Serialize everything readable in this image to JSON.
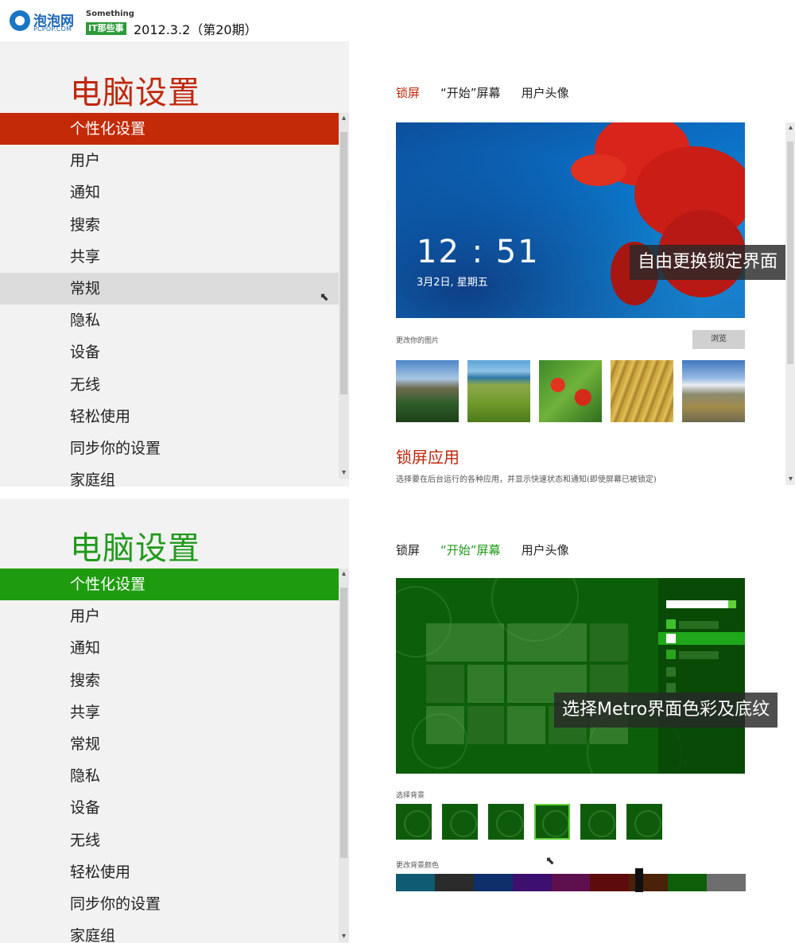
{
  "header": {
    "logo_text": "泡泡网",
    "logo_sub": "PCPOP.COM",
    "something_top": "Something",
    "something_bot": "IT那些事",
    "issue": "2012.3.2（第20期）"
  },
  "panels": [
    {
      "sidebar_title": "电脑设置",
      "items": [
        "个性化设置",
        "用户",
        "通知",
        "搜索",
        "共享",
        "常规",
        "隐私",
        "设备",
        "无线",
        "轻松使用",
        "同步你的设置",
        "家庭组"
      ],
      "tabs": [
        "锁屏",
        "“开始”屏幕",
        "用户头像"
      ],
      "clock": "12 : 51",
      "clock_date": "3月2日, 星期五",
      "callout": "自由更换锁定界面",
      "change_picture_label": "更改你的图片",
      "browse_label": "浏览",
      "section_title": "锁屏应用",
      "section_desc": "选择要在后台运行的各种应用，并显示快速状态和通知(即使屏幕已被锁定)"
    },
    {
      "sidebar_title": "电脑设置",
      "items": [
        "个性化设置",
        "用户",
        "通知",
        "搜索",
        "共享",
        "常规",
        "隐私",
        "设备",
        "无线",
        "轻松使用",
        "同步你的设置",
        "家庭组"
      ],
      "tabs": [
        "锁屏",
        "“开始”屏幕",
        "用户头像"
      ],
      "callout": "选择Metro界面色彩及底纹",
      "select_bg_label": "选择背景",
      "change_bg_color_label": "更改背景颜色",
      "colors": [
        "#0e5b73",
        "#2b2b2b",
        "#0f2f6b",
        "#3d0f6e",
        "#5e0f4d",
        "#5e0b0b",
        "#4a2109",
        "#0e5e0a",
        "#6e6e6e"
      ]
    }
  ],
  "colors": {
    "accent_red": "#c32a07",
    "accent_green": "#1f9b0f"
  }
}
